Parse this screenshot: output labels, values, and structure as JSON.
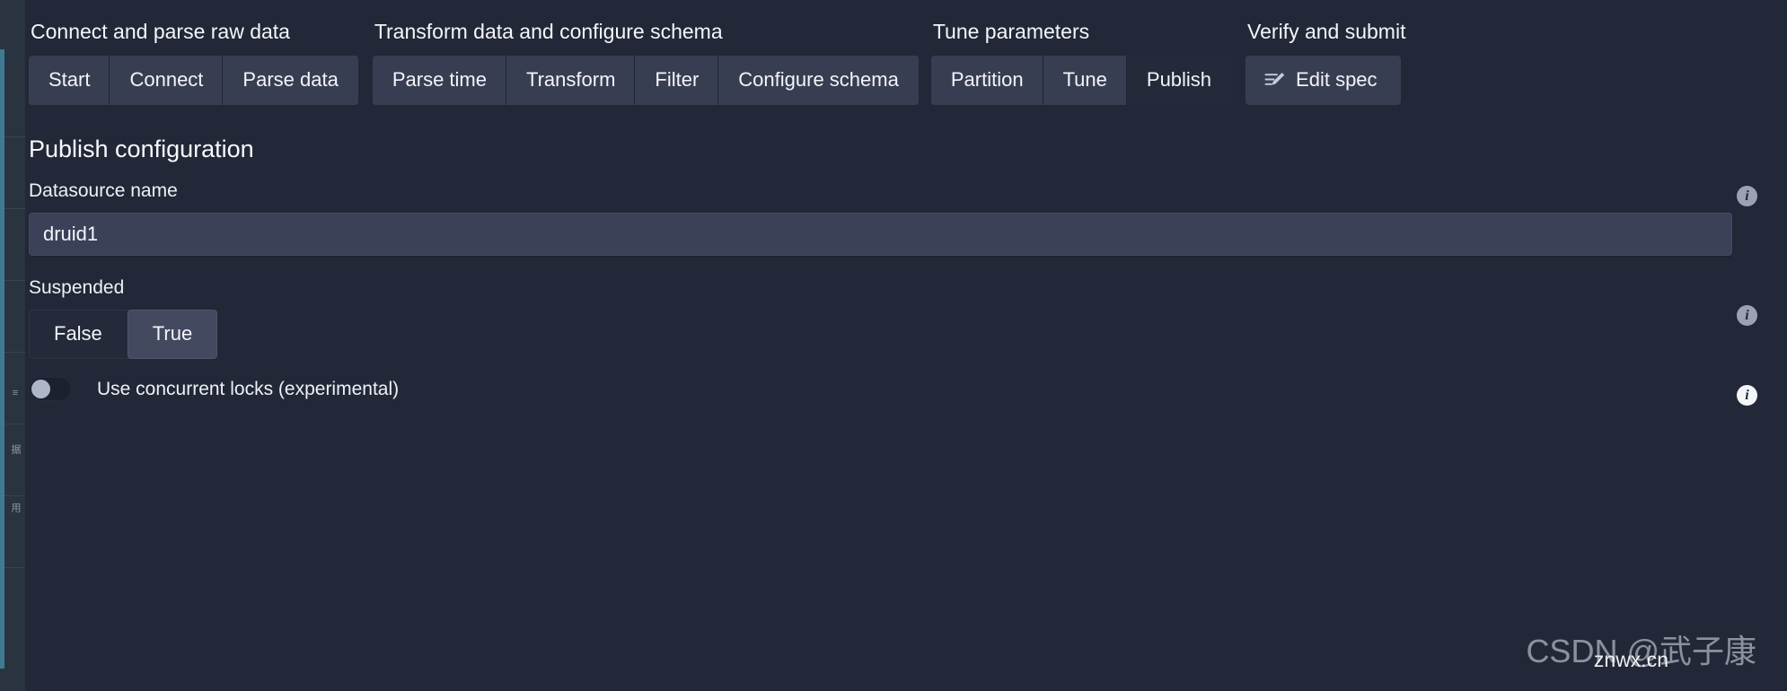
{
  "theme": {
    "background": "#232838",
    "surface_raised": "#383e52",
    "surface_active": "#252a3a",
    "input_background": "#3b4159",
    "text_primary": "#f2f4f8",
    "accent": "#4a7fd4"
  },
  "step_nav": {
    "sections": [
      {
        "title": "Connect and parse raw data",
        "steps": [
          {
            "label": "Start",
            "active": false
          },
          {
            "label": "Connect",
            "active": false
          },
          {
            "label": "Parse data",
            "active": false
          }
        ]
      },
      {
        "title": "Transform data and configure schema",
        "steps": [
          {
            "label": "Parse time",
            "active": false
          },
          {
            "label": "Transform",
            "active": false
          },
          {
            "label": "Filter",
            "active": false
          },
          {
            "label": "Configure schema",
            "active": false
          }
        ]
      },
      {
        "title": "Tune parameters",
        "steps": [
          {
            "label": "Partition",
            "active": false
          },
          {
            "label": "Tune",
            "active": false
          },
          {
            "label": "Publish",
            "active": true
          }
        ]
      },
      {
        "title": "Verify and submit",
        "steps": [
          {
            "label": "Edit spec",
            "icon": "edit-spec-icon",
            "active": false
          }
        ]
      }
    ]
  },
  "page": {
    "title": "Publish configuration"
  },
  "form": {
    "datasource": {
      "label": "Datasource name",
      "value": "druid1",
      "placeholder": "",
      "info_icon": "info-icon"
    },
    "suspended": {
      "label": "Suspended",
      "options": [
        "False",
        "True"
      ],
      "selected": "True",
      "info_icon": "info-icon"
    },
    "concurrent_locks": {
      "label": "Use concurrent locks (experimental)",
      "checked": false,
      "info_icon": "info-icon"
    }
  },
  "watermark": {
    "main": "CSDN @武子康",
    "sub": "znwx.cn"
  }
}
